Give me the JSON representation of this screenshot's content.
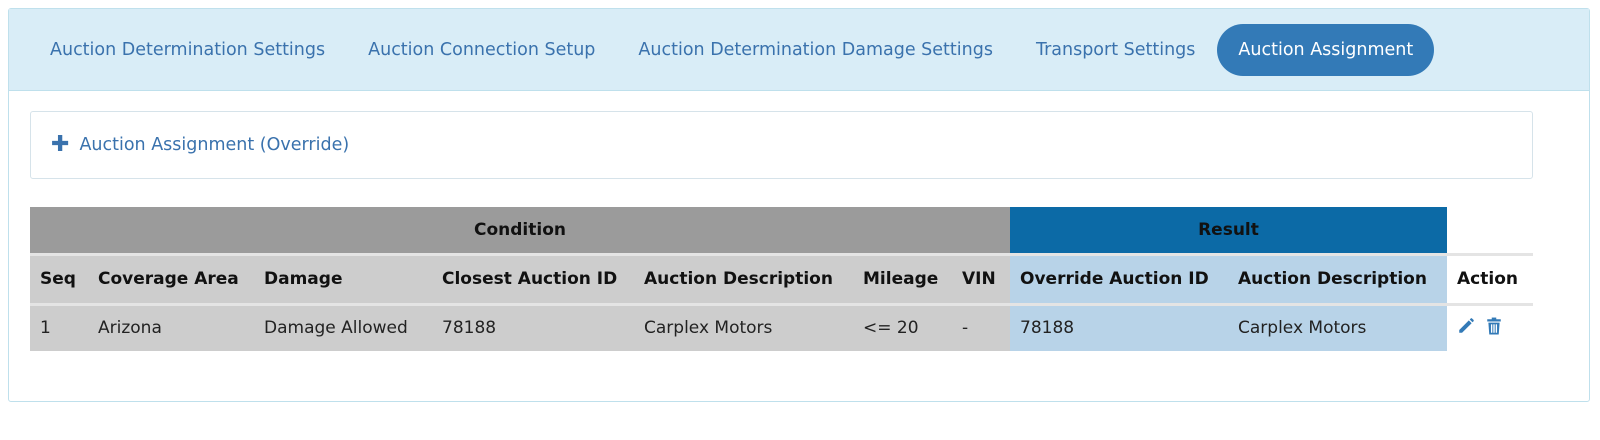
{
  "tabs": [
    {
      "label": "Auction Determination Settings"
    },
    {
      "label": "Auction Connection Setup"
    },
    {
      "label": "Auction Determination Damage Settings"
    },
    {
      "label": "Transport Settings"
    },
    {
      "label": "Auction Assignment"
    }
  ],
  "override": {
    "label": "Auction Assignment (Override)",
    "icon": "plus-icon"
  },
  "table": {
    "groups": {
      "condition": "Condition",
      "result": "Result"
    },
    "headers": {
      "seq": "Seq",
      "coverage_area": "Coverage Area",
      "damage": "Damage",
      "closest_auction_id": "Closest Auction ID",
      "auction_description": "Auction Description",
      "mileage": "Mileage",
      "vin": "VIN",
      "override_auction_id": "Override Auction ID",
      "result_auction_description": "Auction Description",
      "action": "Action"
    },
    "rows": [
      {
        "seq": "1",
        "coverage_area": "Arizona",
        "damage": "Damage Allowed",
        "closest_auction_id": "78188",
        "auction_description": "Carplex Motors",
        "mileage": "<= 20",
        "vin": "-",
        "override_auction_id": "78188",
        "result_auction_description": "Carplex Motors",
        "actions": [
          "edit-icon",
          "trash-icon"
        ]
      }
    ]
  },
  "colors": {
    "tabbar_bg": "#d9edf7",
    "active_tab": "#337ab7",
    "condition_header": "#9b9b9b",
    "result_header": "#0c6aa6",
    "condition_cells": "#cdcdcd",
    "result_cells": "#b8d3e8"
  }
}
